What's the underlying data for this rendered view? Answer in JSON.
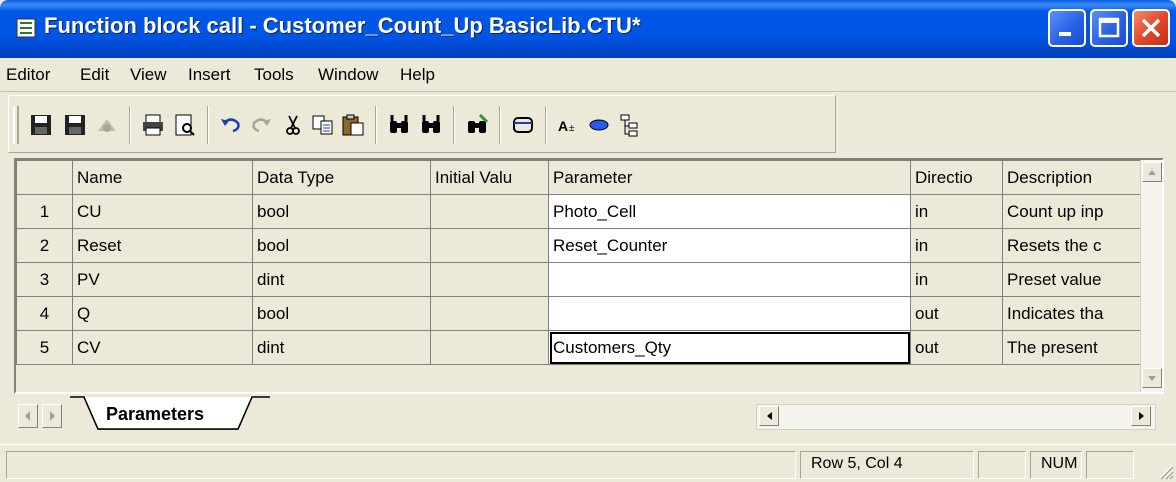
{
  "window": {
    "title": "Function block call - Customer_Count_Up BasicLib.CTU*",
    "minimize_icon": "minimize-icon",
    "maximize_icon": "maximize-icon",
    "close_icon": "close-icon"
  },
  "menu": [
    "Editor",
    "Edit",
    "View",
    "Insert",
    "Tools",
    "Window",
    "Help"
  ],
  "toolbar_icons": [
    "save-icon",
    "save-all-icon",
    "disabled-icon",
    "print-icon",
    "print-preview-icon",
    "undo-icon",
    "redo-icon",
    "cut-icon",
    "copy-icon",
    "paste-icon",
    "find-icon",
    "find-next-icon",
    "replace-icon",
    "insert-icon",
    "font-icon",
    "ellipse-icon",
    "tree-icon"
  ],
  "grid": {
    "headers": [
      "",
      "Name",
      "Data Type",
      "Initial Valu",
      "Parameter",
      "Directio",
      "Description"
    ],
    "rows": [
      {
        "num": "1",
        "name": "CU",
        "type": "bool",
        "initial": "",
        "parameter": "Photo_Cell",
        "direction": "in",
        "description": "Count up inp"
      },
      {
        "num": "2",
        "name": "Reset",
        "type": "bool",
        "initial": "",
        "parameter": "Reset_Counter",
        "direction": "in",
        "description": "Resets the c"
      },
      {
        "num": "3",
        "name": "PV",
        "type": "dint",
        "initial": "",
        "parameter": "",
        "direction": "in",
        "description": "Preset value"
      },
      {
        "num": "4",
        "name": "Q",
        "type": "bool",
        "initial": "",
        "parameter": "",
        "direction": "out",
        "description": "Indicates tha"
      },
      {
        "num": "5",
        "name": "CV",
        "type": "dint",
        "initial": "",
        "parameter": "Customers_Qty",
        "direction": "out",
        "description": "The present"
      }
    ]
  },
  "tabs": {
    "active": "Parameters"
  },
  "status": {
    "position": "Row 5, Col 4",
    "num": "NUM"
  }
}
